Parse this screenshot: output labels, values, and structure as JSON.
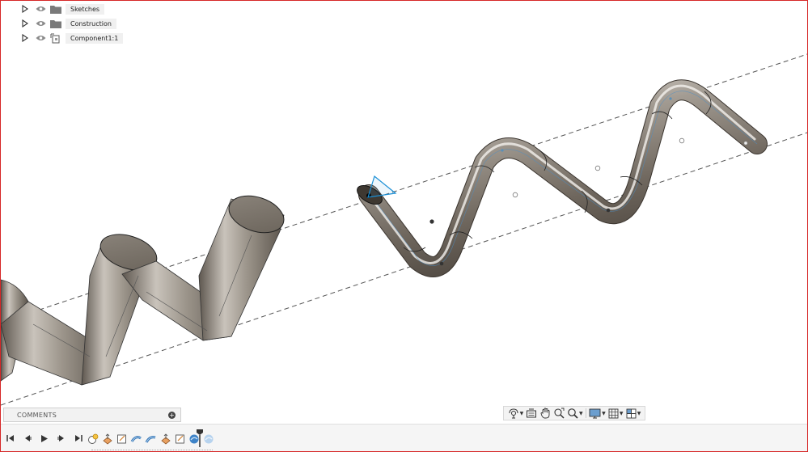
{
  "browser": {
    "items": [
      {
        "label": "Sketches",
        "icon": "folder-icon"
      },
      {
        "label": "Construction",
        "icon": "folder-icon"
      },
      {
        "label": "Component1:1",
        "icon": "component-icon"
      }
    ]
  },
  "comments": {
    "title": "COMMENTS",
    "add_symbol": "+"
  },
  "navbar": {
    "tools": [
      "orbit-icon",
      "look-at-icon",
      "pan-icon",
      "zoom-fit-icon",
      "zoom-icon",
      "display-settings-icon",
      "grid-icon",
      "viewports-icon"
    ]
  },
  "timeline": {
    "playback": [
      "go-to-start-icon",
      "step-back-icon",
      "play-icon",
      "step-forward-icon",
      "go-to-end-icon"
    ],
    "features": [
      "sketch-icon",
      "extrude-icon",
      "sketch-icon",
      "sweep-icon",
      "sweep-icon",
      "extrude-icon",
      "sketch-icon",
      "sweep-icon",
      "sweep-icon"
    ]
  },
  "colors": {
    "accent": "#1a8fd6",
    "metal": "#9a938b",
    "frame": "#d62828"
  }
}
